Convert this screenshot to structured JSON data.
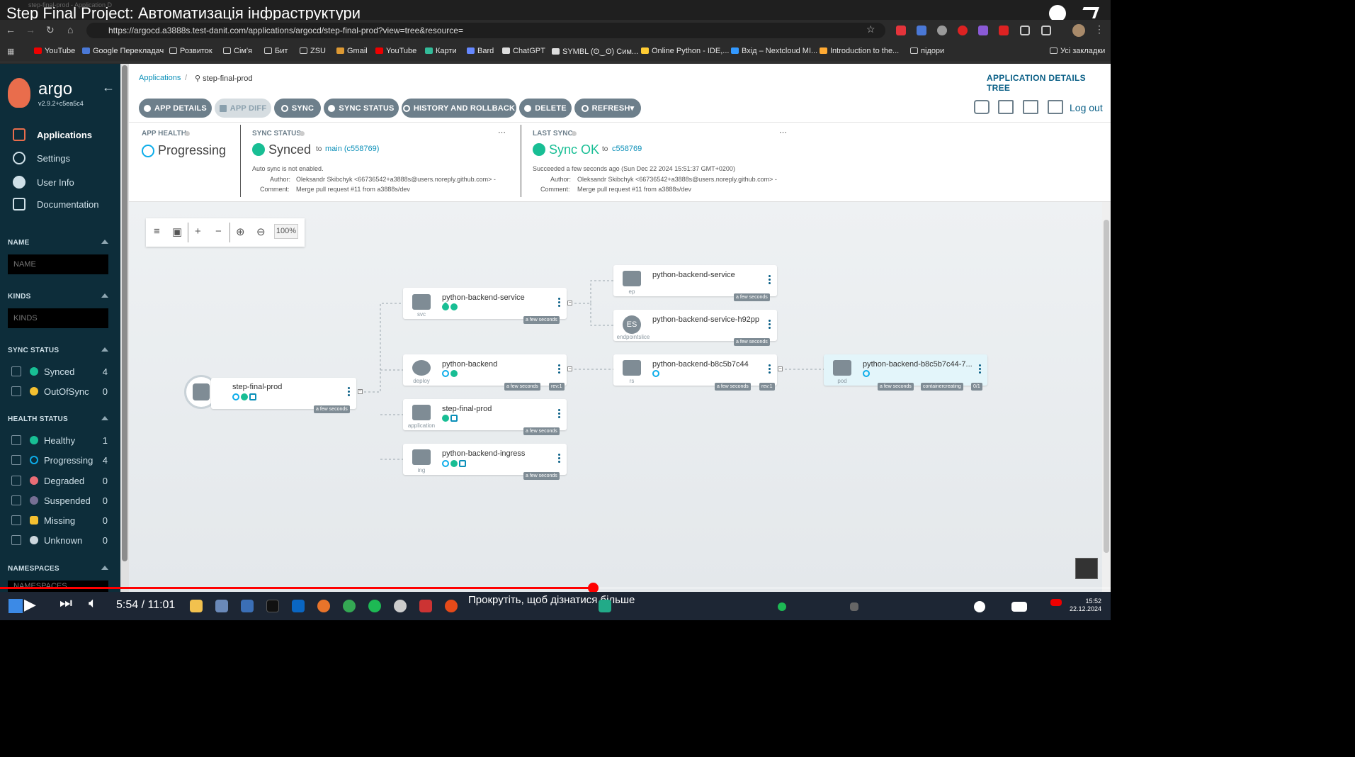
{
  "video": {
    "title": "Step Final Project: Автоматизація інфраструктури",
    "time": "5:54 / 11:01",
    "scroll_hint": "Прокрутіть, щоб дізнатися більше",
    "progress_fraction": 0.53
  },
  "browser": {
    "tab_title": "step-final-prod - Application D",
    "url": "https://argocd.a3888s.test-danit.com/applications/argocd/step-final-prod?view=tree&resource=",
    "bookmarks": [
      "YouTube",
      "Google Перекладач",
      "Розвиток",
      "Сім'я",
      "Бит",
      "ZSU",
      "Gmail",
      "YouTube",
      "Карти",
      "Bard",
      "ChatGPT",
      "SYMBL (ʘ‿ʘ) Сим...",
      "Online Python - IDE,...",
      "Вхід – Nextcloud MI...",
      "Introduction to the...",
      "підори"
    ],
    "all_bookmarks": "Усі закладки"
  },
  "sidebar": {
    "logo": "argo",
    "version": "v2.9.2+c5ea5c4",
    "nav": [
      "Applications",
      "Settings",
      "User Info",
      "Documentation"
    ],
    "name_header": "NAME",
    "name_placeholder": "NAME",
    "kinds_header": "KINDS",
    "kinds_placeholder": "KINDS",
    "sync_header": "SYNC STATUS",
    "sync": [
      {
        "label": "Synced",
        "count": "4",
        "color": "#18be94"
      },
      {
        "label": "OutOfSync",
        "count": "0",
        "color": "#f4c030"
      }
    ],
    "health_header": "HEALTH STATUS",
    "health": [
      {
        "label": "Healthy",
        "count": "1",
        "color": "#18be94"
      },
      {
        "label": "Progressing",
        "count": "4",
        "color": "#0dadea"
      },
      {
        "label": "Degraded",
        "count": "0",
        "color": "#e96d76"
      },
      {
        "label": "Suspended",
        "count": "0",
        "color": "#766f94"
      },
      {
        "label": "Missing",
        "count": "0",
        "color": "#f4c030"
      },
      {
        "label": "Unknown",
        "count": "0",
        "color": "#ccd6dd"
      }
    ],
    "namespaces_header": "NAMESPACES",
    "namespaces_placeholder": "NAMESPACES"
  },
  "header": {
    "breadcrumb_root": "Applications",
    "breadcrumb_current": "step-final-prod",
    "view_title": "APPLICATION DETAILS TREE",
    "logout": "Log out"
  },
  "actions": [
    "APP DETAILS",
    "APP DIFF",
    "SYNC",
    "SYNC STATUS",
    "HISTORY AND ROLLBACK",
    "DELETE",
    "REFRESH"
  ],
  "status": {
    "app_health_label": "APP HEALTH",
    "app_health_value": "Progressing",
    "sync_status_label": "SYNC STATUS",
    "sync_value": "Synced",
    "sync_to": "to",
    "sync_branch": "main (c558769)",
    "auto_sync": "Auto sync is not enabled.",
    "author_label": "Author:",
    "author": "Oleksandr Skibchyk <66736542+a3888s@users.noreply.github.com> -",
    "comment_label": "Comment:",
    "comment": "Merge pull request #11 from a3888s/dev",
    "last_sync_label": "LAST SYNC",
    "last_sync_value": "Sync OK",
    "last_sync_to": "to",
    "last_sync_rev": "c558769",
    "succeeded": "Succeeded a few seconds ago (Sun Dec 22 2024 15:51:37 GMT+0200)"
  },
  "zoom": "100%",
  "tree": {
    "root": {
      "name": "step-final-prod",
      "tag": "a few seconds"
    },
    "svc": {
      "name": "python-backend-service",
      "kind": "svc",
      "tag": "a few seconds"
    },
    "deploy": {
      "name": "python-backend",
      "kind": "deploy",
      "tag": "a few seconds",
      "rev": "rev:1"
    },
    "app": {
      "name": "step-final-prod",
      "kind": "application",
      "tag": "a few seconds"
    },
    "ing": {
      "name": "python-backend-ingress",
      "kind": "ing",
      "tag": "a few seconds"
    },
    "ep": {
      "name": "python-backend-service",
      "kind": "ep",
      "tag": "a few seconds"
    },
    "es": {
      "name": "python-backend-service-h92pp",
      "kind": "endpointslice",
      "tag": "a few seconds",
      "badge": "ES"
    },
    "rs": {
      "name": "python-backend-b8c5b7c44",
      "kind": "rs",
      "tag": "a few seconds",
      "rev": "rev:1"
    },
    "pod": {
      "name": "python-backend-b8c5b7c44-7...",
      "kind": "pod",
      "tag": "a few seconds",
      "state": "containercreating",
      "ready": "0/1"
    }
  },
  "clock": {
    "time": "15:52",
    "date": "22.12.2024"
  }
}
